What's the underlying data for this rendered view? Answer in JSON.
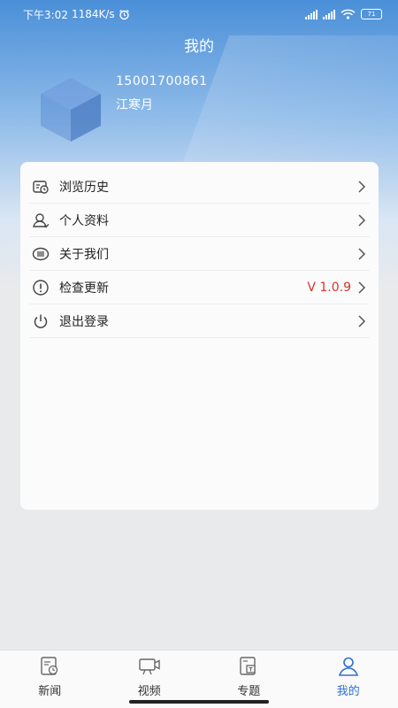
{
  "status_bar": {
    "time": "下午3:02",
    "speed": "1184K/s",
    "battery": "71"
  },
  "header": {
    "title": "我的"
  },
  "profile": {
    "phone": "15001700861",
    "name": "江寒月"
  },
  "menu": {
    "history": "浏览历史",
    "profile": "个人资料",
    "about": "关于我们",
    "update": "检查更新",
    "version": "V 1.0.9",
    "logout": "退出登录"
  },
  "tabs": {
    "news": "新闻",
    "video": "视频",
    "topic": "专题",
    "mine": "我的"
  },
  "colors": {
    "accent": "#2f6fd3",
    "version": "#d9342b"
  }
}
